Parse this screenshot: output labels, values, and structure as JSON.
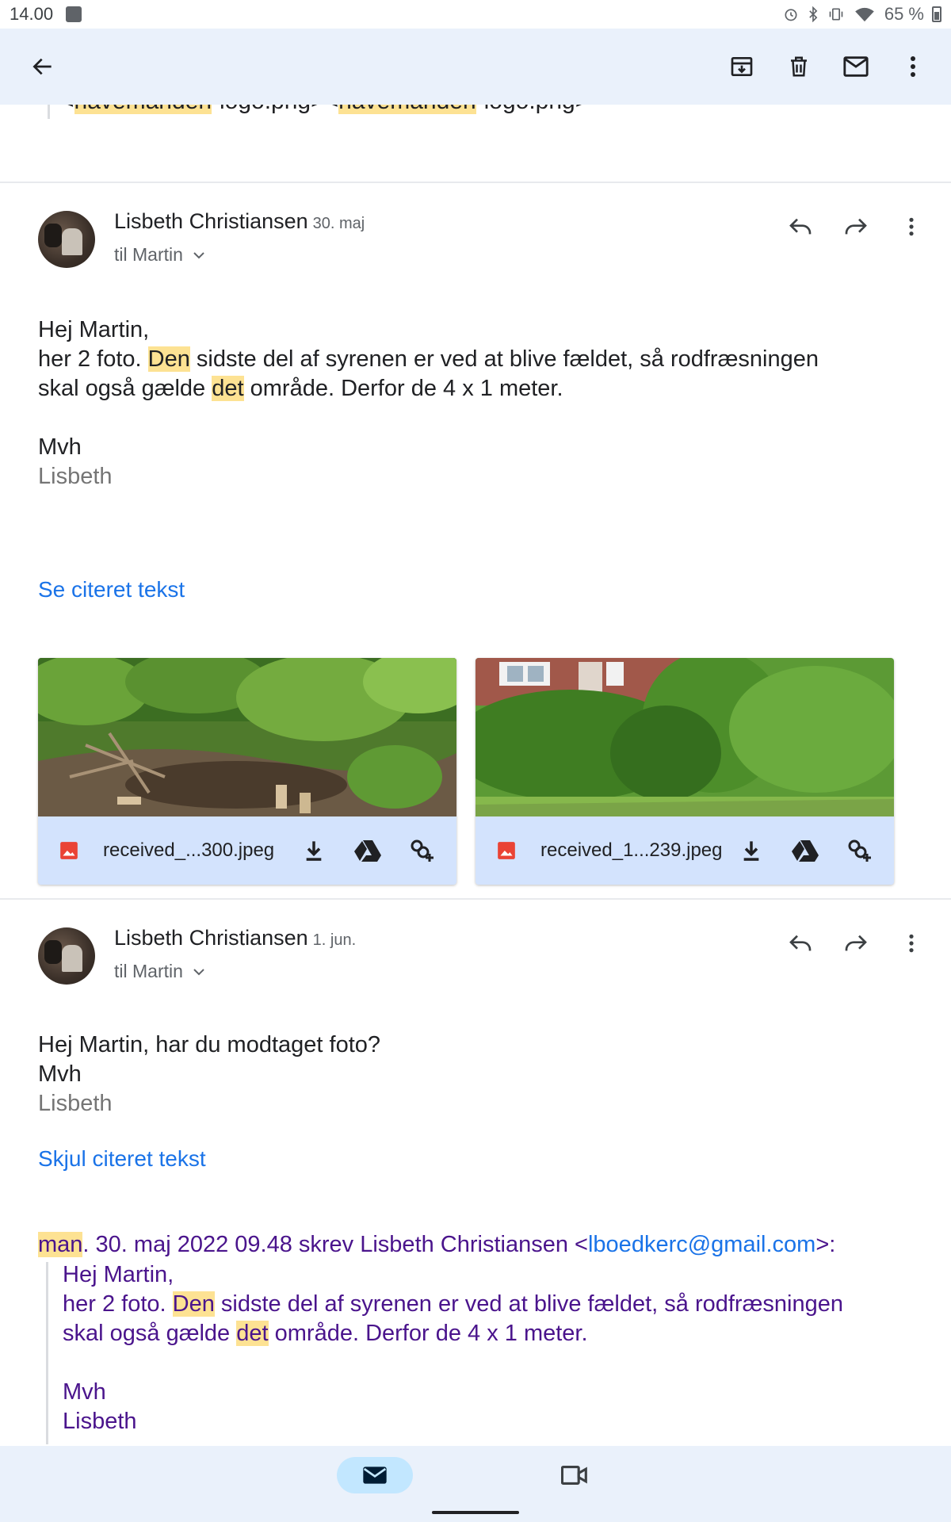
{
  "status_bar": {
    "time": "14.00",
    "battery": "65 %"
  },
  "previous_message": {
    "signature_part1": "havemanden",
    "signature_part2": "-logo.png>",
    "signature_part3": "havemanden",
    "signature_part4": "-logo.png>"
  },
  "messages": [
    {
      "sender": "Lisbeth Christiansen",
      "date": "30. maj",
      "recipient": "til Martin",
      "greeting": "Hej Martin,",
      "line2_a": "her 2 foto. ",
      "line2_hl": "Den",
      "line2_b": " sidste del af syrenen er ved at blive fældet, så rodfræsningen",
      "line3_a": "skal også gælde ",
      "line3_hl": "det",
      "line3_b": " område. Derfor de 4 x 1 meter.",
      "closing": "Mvh",
      "signature": "Lisbeth",
      "quote_toggle": "Se citeret tekst",
      "attachments": [
        {
          "name": "received_...300.jpeg"
        },
        {
          "name": "received_1...239.jpeg"
        }
      ]
    },
    {
      "sender": "Lisbeth Christiansen",
      "date": "1. jun.",
      "recipient": "til Martin",
      "line1": "Hej Martin, har du modtaget foto?",
      "closing": "Mvh",
      "signature": "Lisbeth",
      "quote_toggle": "Skjul citeret tekst",
      "quote_header_hl": "man",
      "quote_header_a": ". 30. maj 2022 09.48 skrev Lisbeth Christiansen <",
      "quote_header_email": "lboedkerc@gmail.com",
      "quote_header_b": ">:",
      "quote_greeting": "Hej Martin,",
      "quote_line2_a": "her 2 foto. ",
      "quote_line2_hl": "Den",
      "quote_line2_b": " sidste del af syrenen er ved at blive fældet, så rodfræsningen",
      "quote_line3_a": "skal også gælde ",
      "quote_line3_hl": "det",
      "quote_line3_b": " område. Derfor de 4 x 1 meter.",
      "quote_closing": "Mvh",
      "quote_signature": "Lisbeth"
    }
  ],
  "colors": {
    "appbar_bg": "#eaf1fb",
    "attachment_bar": "#d3e3fd",
    "link": "#1a73e8",
    "highlight": "#fde293",
    "quote_text": "#4a148c"
  },
  "icons": [
    "back-arrow-icon",
    "archive-icon",
    "delete-icon",
    "mark-unread-icon",
    "more-vert-icon",
    "reply-icon",
    "forward-icon",
    "image-file-icon",
    "download-icon",
    "drive-icon",
    "add-to-photos-icon",
    "mail-icon",
    "video-icon"
  ]
}
